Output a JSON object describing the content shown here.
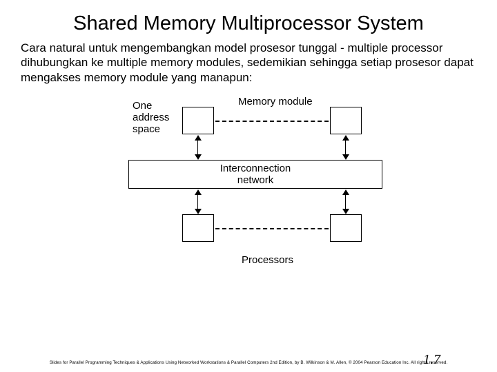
{
  "title": "Shared Memory Multiprocessor System",
  "description": "Cara natural untuk mengembangkan model prosesor tunggal - multiple processor dihubungkan ke multiple memory modules, sedemikian sehingga setiap prosesor dapat mengakses memory module yang manapun:",
  "diagram": {
    "addr_label_l1": "One",
    "addr_label_l2": "address",
    "addr_label_l3": "space",
    "mem_label": "Memory module",
    "interconnect_l1": "Interconnection",
    "interconnect_l2": "network",
    "proc_label": "Processors"
  },
  "footer": "Slides for Parallel Programming Techniques & Applications Using Networked Workstations & Parallel Computers 2nd Edition, by B. Wilkinson & M. Allen, © 2004 Pearson Education Inc. All rights reserved.",
  "page": "1.7"
}
